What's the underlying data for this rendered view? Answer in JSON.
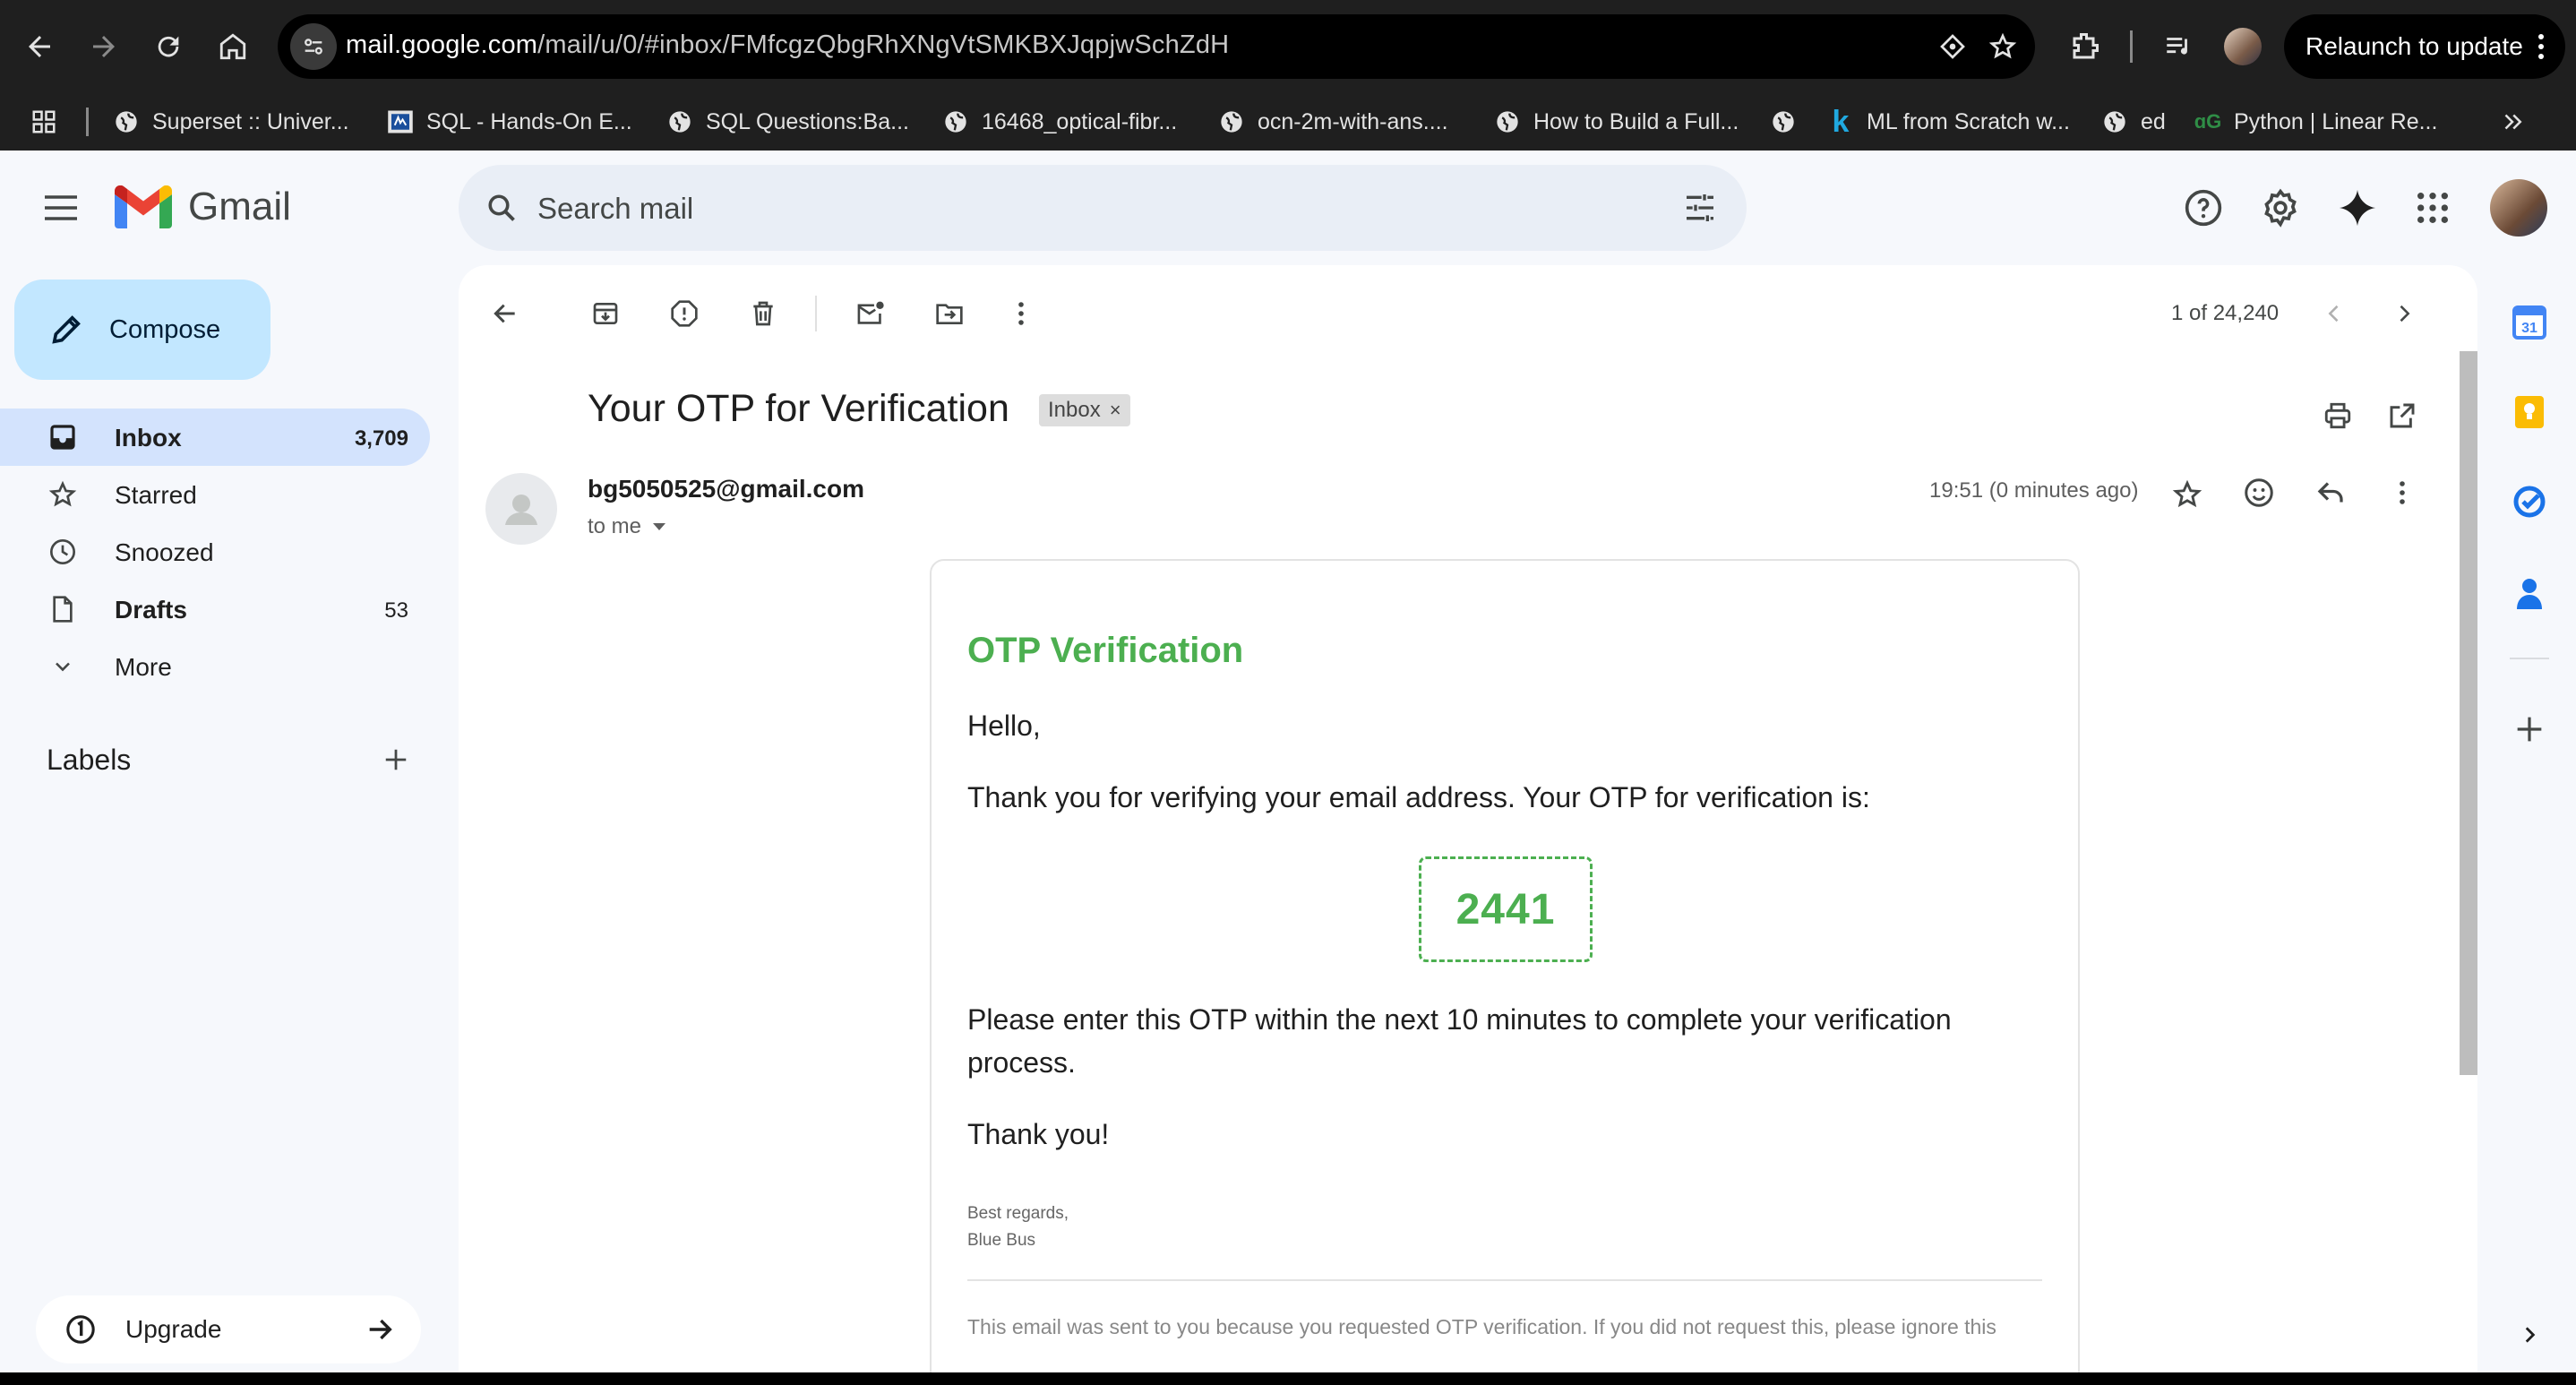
{
  "browser": {
    "url_host": "mail.google.com",
    "url_path": "/mail/u/0/#inbox/FMfcgzQbgRhXNgVtSMKBXJqpjwSchZdH",
    "relaunch_label": "Relaunch to update",
    "bookmarks": [
      {
        "label": "Superset :: Univer...",
        "icon": "globe-icon"
      },
      {
        "label": "SQL - Hands-On E...",
        "icon": "course-icon"
      },
      {
        "label": "SQL Questions:Ba...",
        "icon": "globe-icon"
      },
      {
        "label": "16468_optical-fibr...",
        "icon": "globe-icon"
      },
      {
        "label": "ocn-2m-with-ans....",
        "icon": "globe-icon"
      },
      {
        "label": "How to Build a Full...",
        "icon": "globe-icon"
      },
      {
        "label": "",
        "icon": "globe-icon"
      },
      {
        "label": "ML from Scratch w...",
        "icon": "k-icon"
      },
      {
        "label": "ed",
        "icon": "globe-icon"
      },
      {
        "label": "Python | Linear Re...",
        "icon": "gfg-icon"
      }
    ]
  },
  "gmail": {
    "app_name": "Gmail",
    "search_placeholder": "Search mail",
    "compose_label": "Compose",
    "nav": [
      {
        "label": "Inbox",
        "count": "3,709"
      },
      {
        "label": "Starred",
        "count": ""
      },
      {
        "label": "Snoozed",
        "count": ""
      },
      {
        "label": "Drafts",
        "count": "53"
      },
      {
        "label": "More",
        "count": ""
      }
    ],
    "labels_header": "Labels",
    "upgrade_label": "Upgrade",
    "pager": "1 of 24,240"
  },
  "email": {
    "subject": "Your OTP for Verification",
    "chip": "Inbox",
    "chip_close": "×",
    "sender": "bg5050525@gmail.com",
    "to": "to me",
    "timestamp": "19:51 (0 minutes ago)",
    "heading": "OTP Verification",
    "greeting": "Hello,",
    "intro": "Thank you for verifying your email address. Your OTP for verification is:",
    "otp": "2441",
    "instruction_line1": "Please enter this OTP within the next 10 minutes to complete your verification",
    "instruction_line2": "process.",
    "thanks": "Thank you!",
    "signoff": "Best regards,",
    "signature": "Blue Bus",
    "footer": "This email was sent to you because you requested OTP verification. If you did not request this, please ignore this"
  },
  "side_panel": {
    "calendar_badge": "31"
  },
  "colors": {
    "otp_green": "#4caf50",
    "compose_bg": "#c2e7ff",
    "active_nav": "#d3e3fd",
    "app_bg": "#f6f8fc"
  }
}
